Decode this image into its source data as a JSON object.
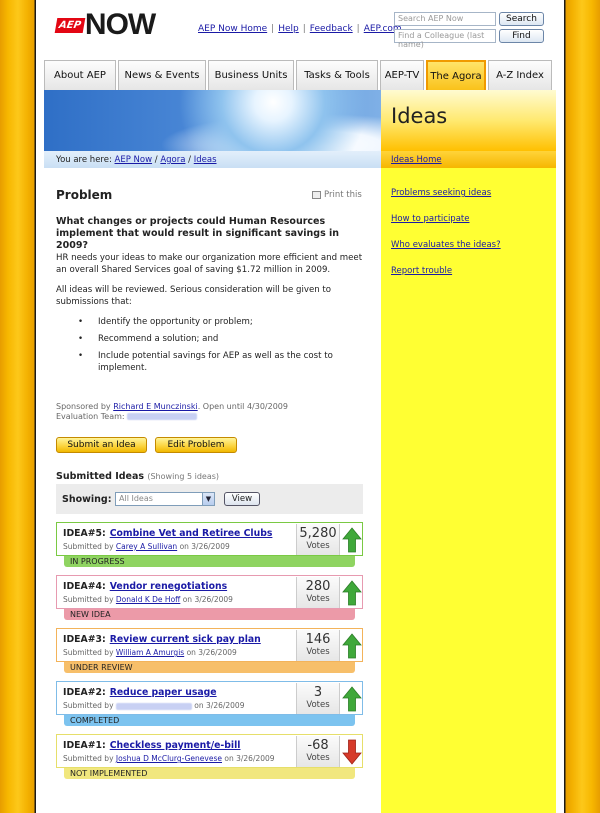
{
  "header": {
    "logo_badge": "AEP",
    "logo_text": "NOW",
    "links": [
      "AEP Now Home",
      "Help",
      "Feedback",
      "AEP.com"
    ],
    "search_placeholder": "Search AEP Now",
    "search_button": "Search",
    "colleague_placeholder": "Find a Colleague (last name)",
    "find_button": "Find"
  },
  "nav": {
    "tabs": [
      "About AEP",
      "News & Events",
      "Business Units",
      "Tasks & Tools",
      "AEP-TV",
      "The Agora",
      "A-Z Index"
    ],
    "active": "The Agora"
  },
  "breadcrumb": {
    "prefix": "You are here:",
    "items": [
      "AEP Now",
      "Agora",
      "Ideas"
    ]
  },
  "sidebar": {
    "title": "Ideas",
    "home_link": "Ideas Home",
    "links": [
      "Problems seeking ideas",
      "How to participate",
      "Who evaluates the ideas?",
      "Report trouble"
    ]
  },
  "problem": {
    "heading": "Problem",
    "print_label": "Print this",
    "question": "What changes or projects could Human Resources implement that would result in significant savings in 2009?",
    "para1": "HR needs your ideas to make our organization more efficient and meet an overall Shared Services goal of saving $1.72 million in 2009.",
    "para2": "All ideas will be reviewed. Serious consideration will be given to submissions that:",
    "bullets": [
      "Identify the opportunity or problem;",
      "Recommend a solution; and",
      "Include potential savings for AEP as well as the cost to implement."
    ],
    "sponsored_prefix": "Sponsored by",
    "sponsor": "Richard E Munczinski",
    "open_until": ". Open until 4/30/2009",
    "eval_team": "Evaluation Team:"
  },
  "actions": {
    "submit": "Submit an Idea",
    "edit": "Edit Problem"
  },
  "submitted": {
    "heading": "Submitted Ideas",
    "count_note": "(Showing 5 ideas)",
    "showing_label": "Showing:",
    "filter_value": "All Ideas",
    "view_button": "View"
  },
  "ideas": [
    {
      "id": "IDEA#5:",
      "title": "Combine Vet and Retiree Clubs",
      "by": "Carey A Sullivan",
      "date": "on 3/26/2009",
      "votes": "5,280",
      "votes_label": "Votes",
      "status": "IN PROGRESS",
      "direction": "up",
      "border": "#7ac943",
      "status_color": "#8fd461"
    },
    {
      "id": "IDEA#4:",
      "title": "Vendor renegotiations",
      "by": "Donald K De Hoff",
      "date": "on 3/26/2009",
      "votes": "280",
      "votes_label": "Votes",
      "status": "NEW IDEA",
      "direction": "up",
      "border": "#e79ab0",
      "status_color": "#ec9aa8"
    },
    {
      "id": "IDEA#3:",
      "title": "Review current sick pay plan",
      "by": "William A Amurgis",
      "date": "on 3/26/2009",
      "votes": "146",
      "votes_label": "Votes",
      "status": "UNDER REVIEW",
      "direction": "up",
      "border": "#f3b35a",
      "status_color": "#f7bf6a"
    },
    {
      "id": "IDEA#2:",
      "title": "Reduce paper usage",
      "by": "",
      "date": "on 3/26/2009",
      "votes": "3",
      "votes_label": "Votes",
      "status": "COMPLETED",
      "direction": "up",
      "border": "#7fbce8",
      "status_color": "#7cc3ef"
    },
    {
      "id": "IDEA#1:",
      "title": "Checkless payment/e-bill",
      "by": "Joshua D McClurg-Genevese",
      "date": "on 3/26/2009",
      "votes": "-68",
      "votes_label": "Votes",
      "status": "NOT IMPLEMENTED",
      "direction": "down",
      "border": "#e6df6a",
      "status_color": "#f1e77e"
    }
  ],
  "submitted_by_prefix": "Submitted by",
  "colors": {
    "frame": "#f7b700",
    "sidebar": "#ffff33",
    "up_arrow": "#3fa83a",
    "down_arrow": "#d63a2a"
  }
}
